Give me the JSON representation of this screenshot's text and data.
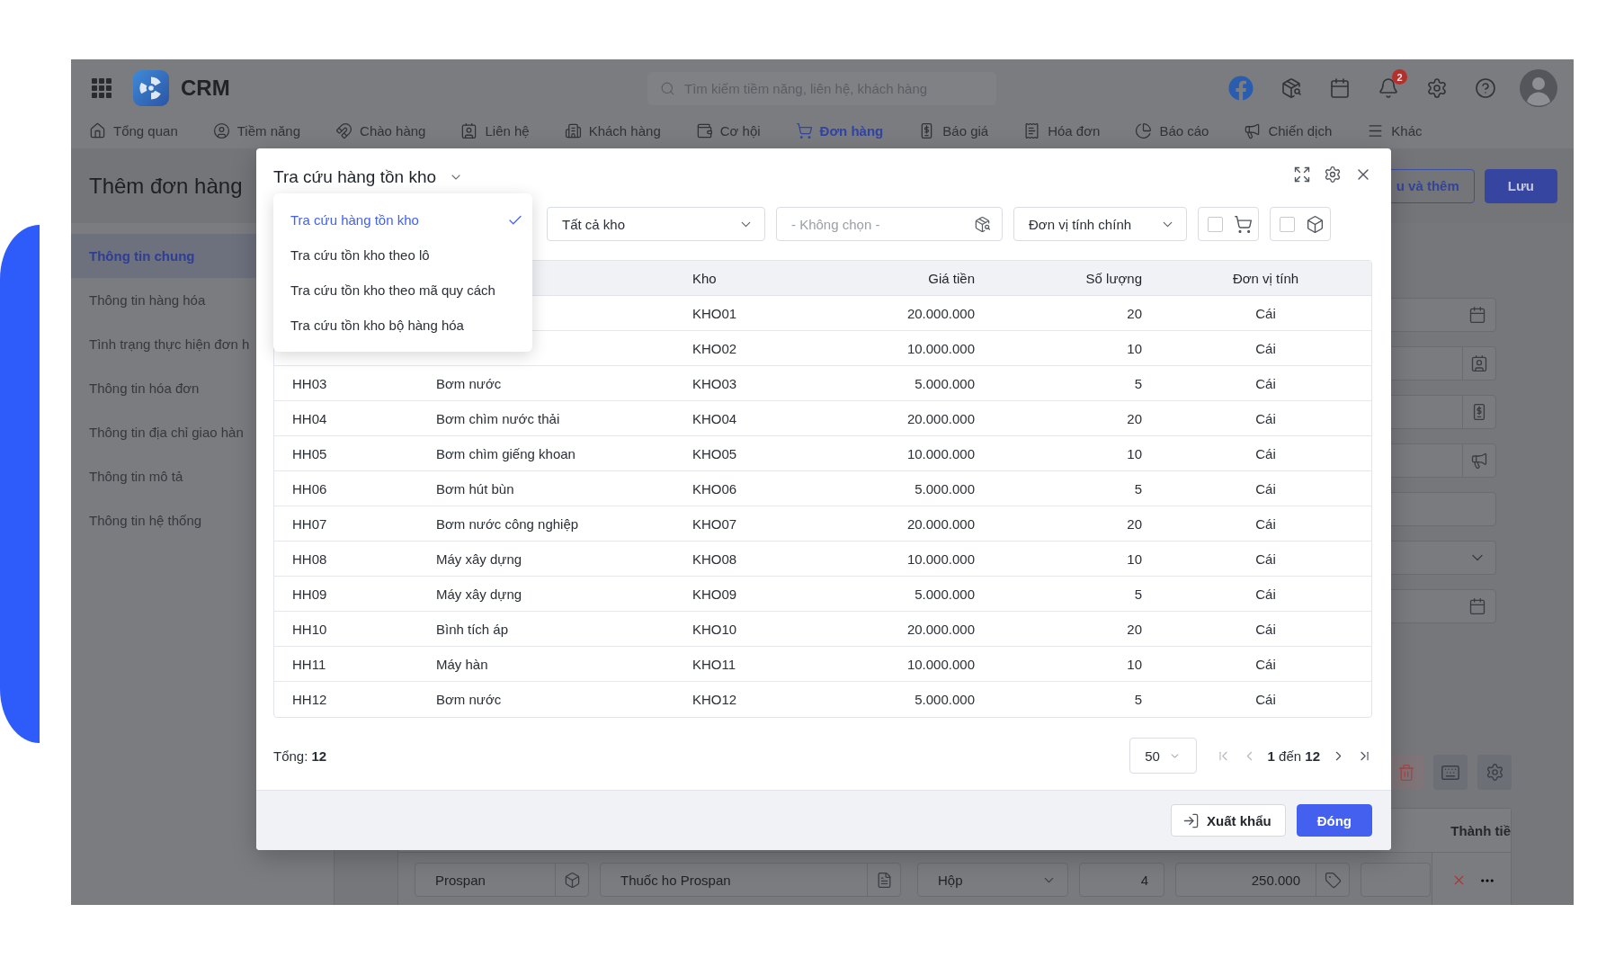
{
  "app": {
    "name": "CRM",
    "search": {
      "placeholder": "Tìm kiếm tiềm năng, liên hệ, khách hàng"
    },
    "notification_badge": "2"
  },
  "nav": [
    {
      "label": "Tổng quan",
      "selected": false
    },
    {
      "label": "Tiềm năng",
      "selected": false
    },
    {
      "label": "Chào hàng",
      "selected": false
    },
    {
      "label": "Liên hệ",
      "selected": false
    },
    {
      "label": "Khách hàng",
      "selected": false
    },
    {
      "label": "Cơ hội",
      "selected": false
    },
    {
      "label": "Đơn hàng",
      "selected": true
    },
    {
      "label": "Báo giá",
      "selected": false
    },
    {
      "label": "Hóa đơn",
      "selected": false
    },
    {
      "label": "Báo cáo",
      "selected": false
    },
    {
      "label": "Chiến dịch",
      "selected": false
    },
    {
      "label": "Khác",
      "selected": false
    }
  ],
  "page": {
    "title": "Thêm đơn hàng",
    "buttons": [
      {
        "label": "u và thêm",
        "kind": "outline"
      },
      {
        "label": "Lưu",
        "kind": "primary"
      }
    ]
  },
  "sidebar": {
    "items": [
      {
        "label": "Thông tin chung",
        "selected": true
      },
      {
        "label": "Thông tin hàng hóa",
        "selected": false
      },
      {
        "label": "Tình trạng thực hiện đơn h",
        "selected": false
      },
      {
        "label": "Thông tin hóa đơn",
        "selected": false
      },
      {
        "label": "Thông tin địa chỉ giao hàn",
        "selected": false
      },
      {
        "label": "Thông tin mô tả",
        "selected": false
      },
      {
        "label": "Thông tin hệ thống",
        "selected": false
      }
    ]
  },
  "form_fields": [
    {
      "kind": "date"
    },
    {
      "kind": "contact"
    },
    {
      "kind": "quote"
    },
    {
      "kind": "campaign"
    },
    {
      "kind": "text"
    },
    {
      "kind": "select"
    },
    {
      "kind": "date"
    }
  ],
  "items_table": {
    "columns": [
      "Thành tiề"
    ],
    "rows": [
      {
        "cells": [
          {
            "kind": "lookup",
            "value": "Prospan"
          },
          {
            "kind": "note",
            "value": "Thuốc ho Prospan"
          },
          {
            "kind": "select",
            "value": "Hộp"
          },
          {
            "kind": "number",
            "value": "4"
          },
          {
            "kind": "price",
            "value": "250.000"
          },
          {
            "kind": "blank"
          }
        ]
      }
    ]
  },
  "dialog": {
    "title": "Tra cứu hàng tồn kho",
    "mode_menu": {
      "expanded": true,
      "items": [
        {
          "label": "Tra cứu hàng tồn kho",
          "selected": true
        },
        {
          "label": "Tra cứu tồn kho theo lô",
          "selected": false
        },
        {
          "label": "Tra cứu tồn kho theo mã quy cách",
          "selected": false
        },
        {
          "label": "Tra cứu tồn kho bộ hàng hóa",
          "selected": false
        }
      ]
    },
    "filters": [
      {
        "kind": "select",
        "value": "Tất cả kho"
      },
      {
        "kind": "lookup",
        "placeholder": "- Không chọn -"
      },
      {
        "kind": "select",
        "value": "Đơn vị tính chính"
      }
    ],
    "toggles": [
      {
        "checked": false
      },
      {
        "checked": false
      }
    ],
    "table": {
      "columns": [
        "Kho",
        "Giá tiền",
        "Số lượng",
        "Đơn vị tính"
      ],
      "rows": [
        {
          "cells": [
            "KHO01",
            "20.000.000",
            "20",
            "Cái"
          ]
        },
        {
          "cells": [
            "KHO02",
            "10.000.000",
            "10",
            "Cái"
          ]
        },
        {
          "column_1": "HH03",
          "column_2": "Bơm nước",
          "cells": [
            "KHO03",
            "5.000.000",
            "5",
            "Cái"
          ]
        },
        {
          "column_1": "HH04",
          "column_2": "Bơm chìm nước thải",
          "cells": [
            "KHO04",
            "20.000.000",
            "20",
            "Cái"
          ]
        },
        {
          "column_1": "HH05",
          "column_2": "Bơm chìm giếng khoan",
          "cells": [
            "KHO05",
            "10.000.000",
            "10",
            "Cái"
          ]
        },
        {
          "column_1": "HH06",
          "column_2": "Bơm hút bùn",
          "cells": [
            "KHO06",
            "5.000.000",
            "5",
            "Cái"
          ]
        },
        {
          "column_1": "HH07",
          "column_2": "Bơm nước công nghiệp",
          "cells": [
            "KHO07",
            "20.000.000",
            "20",
            "Cái"
          ]
        },
        {
          "column_1": "HH08",
          "column_2": "Máy xây dựng",
          "cells": [
            "KHO08",
            "10.000.000",
            "10",
            "Cái"
          ]
        },
        {
          "column_1": "HH09",
          "column_2": "Máy xây dựng",
          "cells": [
            "KHO09",
            "5.000.000",
            "5",
            "Cái"
          ]
        },
        {
          "column_1": "HH10",
          "column_2": "Bình tích áp",
          "cells": [
            "KHO10",
            "20.000.000",
            "20",
            "Cái"
          ]
        },
        {
          "column_1": "HH11",
          "column_2": "Máy hàn",
          "cells": [
            "KHO11",
            "10.000.000",
            "10",
            "Cái"
          ]
        },
        {
          "column_1": "HH12",
          "column_2": "Bơm nước",
          "cells": [
            "KHO12",
            "5.000.000",
            "5",
            "Cái"
          ]
        }
      ]
    },
    "total": "Tổng: **12**",
    "page_size": "50",
    "pagination": {
      "range": "**1** đến **12**",
      "previous_disabled": true,
      "next_disabled": false
    },
    "buttons": [
      {
        "label": "Xuất khẩu",
        "kind": "export"
      },
      {
        "label": "Đóng",
        "kind": "primary"
      }
    ]
  }
}
